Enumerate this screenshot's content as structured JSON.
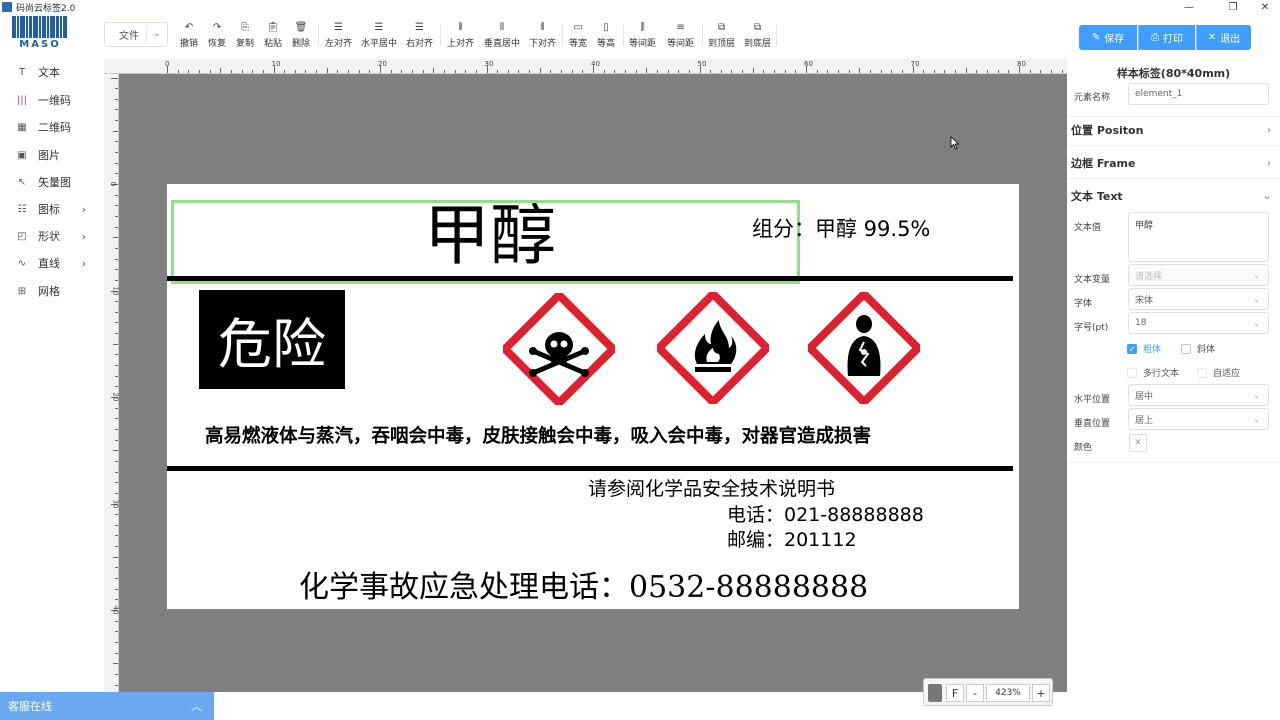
{
  "app": {
    "title": "码尚云标签2.0",
    "logo_text": "MASO"
  },
  "window_controls": {
    "minimize": "—",
    "restore": "❐",
    "close": "✕"
  },
  "file_menu": {
    "label": "文件"
  },
  "toolbar": {
    "undo": "撤销",
    "redo": "恢复",
    "copy": "复制",
    "paste": "粘贴",
    "delete": "删除",
    "align_left": "左对齐",
    "align_hcenter": "水平居中",
    "align_right": "右对齐",
    "align_top": "上对齐",
    "align_vcenter": "垂直居中",
    "align_bottom": "下对齐",
    "same_width": "等宽",
    "same_height": "等高",
    "equal_hspace": "等间距",
    "equal_vspace": "等间距",
    "bring_front": "到顶层",
    "send_back": "到底层"
  },
  "actions": {
    "save": "保存",
    "print": "打印",
    "exit": "退出"
  },
  "sidebar": {
    "items": [
      {
        "label": "文本",
        "icon": "T"
      },
      {
        "label": "一维码",
        "icon": "|||"
      },
      {
        "label": "二维码",
        "icon": "▦"
      },
      {
        "label": "图片",
        "icon": "▣"
      },
      {
        "label": "矢量图",
        "icon": "↖"
      },
      {
        "label": "图标",
        "icon": "☷"
      },
      {
        "label": "形状",
        "icon": "◰"
      },
      {
        "label": "直线",
        "icon": "∿"
      },
      {
        "label": "网格",
        "icon": "⊞"
      }
    ]
  },
  "ruler": {
    "h_labels": [
      "0",
      "10",
      "20",
      "30",
      "40",
      "50",
      "60",
      "70",
      "80"
    ],
    "v_labels": [
      "0",
      "10",
      "20",
      "30",
      "40"
    ]
  },
  "label": {
    "title": "甲醇",
    "component": "组分：甲醇 99.5%",
    "danger": "危险",
    "hazard_statement": "高易燃液体与蒸汽，吞咽会中毒，皮肤接触会中毒，吸入会中毒，对器官造成损害",
    "refer": "请参阅化学品安全技术说明书",
    "phone": "电话：021-88888888",
    "postal": "邮编：201112",
    "emergency": "化学事故应急处理电话：0532-88888888",
    "pictograms": [
      "skull-crossbones",
      "flame",
      "health-hazard"
    ]
  },
  "zoom": {
    "fit": "F",
    "minus": "-",
    "value": "423%",
    "plus": "+"
  },
  "panel": {
    "title": "样本标签(80*40mm)",
    "element_name_label": "元素名称",
    "element_name": "element_1",
    "sections": {
      "position": "位置 Positon",
      "frame": "边框 Frame",
      "text": "文本 Text"
    },
    "text_value_label": "文本值",
    "text_value": "甲醇",
    "text_var_label": "文本变量",
    "text_var_placeholder": "请选择",
    "font_label": "字体",
    "font_value": "宋体",
    "size_label": "字号(pt)",
    "size_value": "18",
    "bold": "粗体",
    "italic": "斜体",
    "multiline": "多行文本",
    "auto_fit": "自适应",
    "halign_label": "水平位置",
    "halign_value": "居中",
    "valign_label": "垂直位置",
    "valign_value": "居上",
    "color_label": "颜色"
  },
  "customer_service": "客服在线",
  "colors": {
    "accent": "#409eff",
    "ghs_red": "#e0202f",
    "selection": "#8fe08a",
    "canvas": "#7f7f7f"
  }
}
